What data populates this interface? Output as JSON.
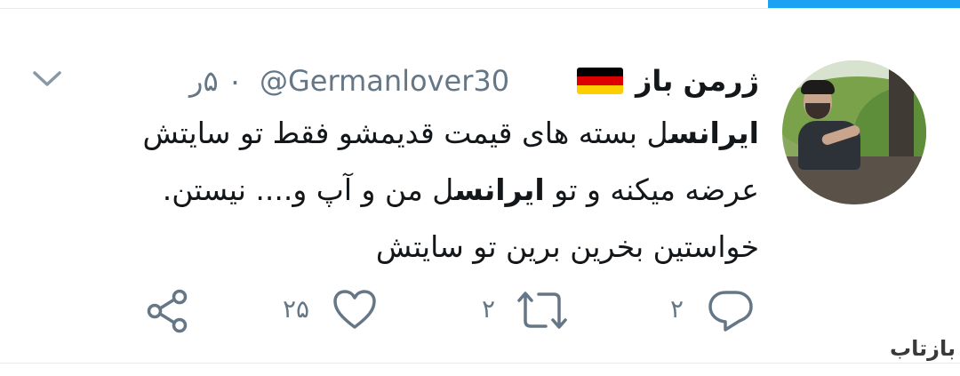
{
  "tweet": {
    "author_name": "ژرمن باز",
    "handle": "@Germanlover30",
    "time": "۰ ۵ر",
    "text_lines": [
      {
        "bold": "ایرانس",
        "rest": "ل بسته های قیمت قدیمشو فقط تو سایتش"
      },
      {
        "before": "عرضه میکنه و تو ",
        "bold": "ایرانس",
        "after": "ل من و آپ و.... نیستن."
      },
      {
        "plain": "خواستین بخرین برین تو سایتش"
      }
    ]
  },
  "actions": {
    "reply_count": "۲",
    "retweet_count": "۲",
    "like_count": "۲۵"
  },
  "flag_colors": [
    "#000000",
    "#dd0000",
    "#ffce00"
  ],
  "icons": {
    "more": "chevron-down-icon",
    "share": "share-icon",
    "like": "heart-icon",
    "retweet": "retweet-icon",
    "reply": "reply-icon"
  },
  "watermark": "بازتاب",
  "colors": {
    "accent": "#1da1f2",
    "text": "#14171a",
    "secondary": "#657786"
  }
}
